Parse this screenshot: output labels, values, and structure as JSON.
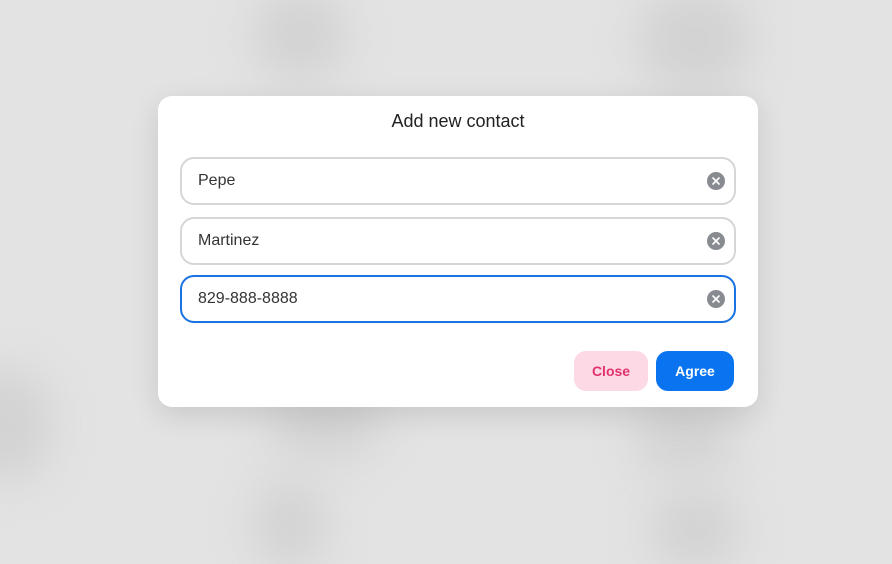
{
  "dialog": {
    "title": "Add new contact",
    "fields": [
      {
        "value": "Pepe"
      },
      {
        "value": "Martinez"
      },
      {
        "value": "829-888-8888"
      }
    ],
    "buttons": {
      "close_label": "Close",
      "agree_label": "Agree"
    }
  },
  "colors": {
    "accent": "#0a74f0",
    "focus_border": "#1a73e0",
    "close_bg": "#fcd9e4",
    "close_text": "#e0336e",
    "backdrop": "#e3e3e3"
  },
  "icons": {
    "clear": "clear-circle-x-icon"
  }
}
